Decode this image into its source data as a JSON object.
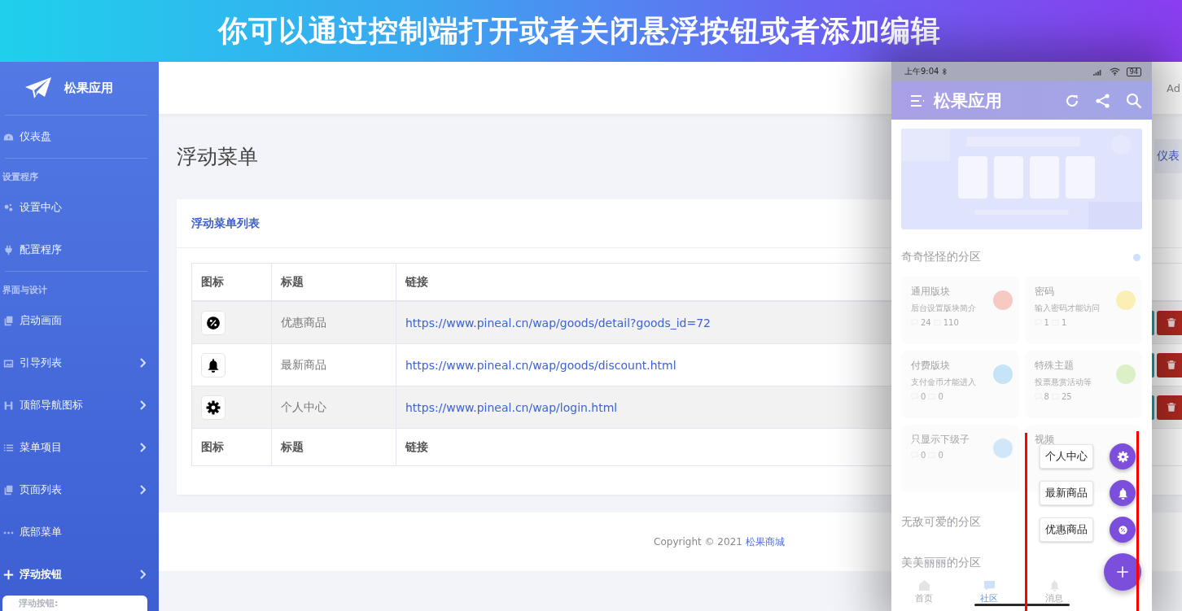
{
  "banner": {
    "title": "你可以通过控制端打开或者关闭悬浮按钮或者添加编辑"
  },
  "sidebar": {
    "brand": "松果应用",
    "groups": [
      {
        "items": [
          {
            "label": "仪表盘",
            "expandable": false,
            "selected": false
          }
        ]
      },
      {
        "label": "设置程序",
        "items": [
          {
            "label": "设置中心",
            "expandable": false,
            "selected": false
          },
          {
            "label": "配置程序",
            "expandable": false,
            "selected": false
          }
        ]
      },
      {
        "label": "界面与设计",
        "items": [
          {
            "label": "启动画面",
            "expandable": false,
            "selected": false
          },
          {
            "label": "引导列表",
            "expandable": true,
            "selected": false
          },
          {
            "label": "顶部导航图标",
            "expandable": true,
            "selected": false
          },
          {
            "label": "菜单项目",
            "expandable": true,
            "selected": false
          },
          {
            "label": "页面列表",
            "expandable": true,
            "selected": false
          },
          {
            "label": "底部菜单",
            "expandable": false,
            "selected": false
          },
          {
            "label": "浮动按钮",
            "expandable": true,
            "expanded": true,
            "selected": true,
            "children": [
              {
                "label": "浮动按钮:"
              }
            ]
          }
        ]
      }
    ]
  },
  "header": {
    "user": "Ad"
  },
  "page": {
    "title": "浮动菜单",
    "breadcrumb": "仪表"
  },
  "card": {
    "title": "浮动菜单列表",
    "columns": [
      "图标",
      "标题",
      "链接"
    ],
    "rows": [
      {
        "title": "优惠商品",
        "link": "https://www.pineal.cn/wap/goods/detail?goods_id=72"
      },
      {
        "title": "最新商品",
        "link": "https://www.pineal.cn/wap/goods/discount.html"
      },
      {
        "title": "个人中心",
        "link": "https://www.pineal.cn/wap/login.html"
      }
    ],
    "footer_columns": [
      "图标",
      "标题",
      "链接"
    ]
  },
  "footer": {
    "text": "Copyright © 2021",
    "link": "松果商城"
  },
  "phone": {
    "status_bar": {
      "time": "上午9:04",
      "battery": "94"
    },
    "app_title": "松果应用",
    "sections": [
      {
        "title": "奇奇怪怪的分区",
        "forums": [
          {
            "title": "通用版块",
            "description": "后台设置版块简介",
            "comments": "24",
            "posts": "110",
            "color": "#f6c9c2"
          },
          {
            "title": "密码",
            "description": "输入密码才能访问",
            "comments": "1",
            "posts": "1",
            "color": "#fbefb3"
          },
          {
            "title": "付费版块",
            "description": "支付金币才能进入",
            "comments": "0",
            "posts": "0",
            "color": "#c6e4f8"
          },
          {
            "title": "特殊主题",
            "description": "投票悬赏活动等",
            "comments": "8",
            "posts": "25",
            "color": "#dcefc7"
          },
          {
            "title": "只显示下级子",
            "comments": "0",
            "posts": "0",
            "color": "#cfe7f8"
          },
          {
            "title": "视频"
          }
        ]
      },
      {
        "title": "无敌可爱的分区"
      },
      {
        "title": "美美丽丽的分区"
      }
    ],
    "tabs": [
      {
        "label": "首页",
        "selected": false
      },
      {
        "label": "社区",
        "selected": true
      },
      {
        "label": "消息",
        "selected": false
      }
    ],
    "fab": {
      "items": [
        {
          "label": "个人中心"
        },
        {
          "label": "最新商品"
        },
        {
          "label": "优惠商品"
        }
      ]
    }
  }
}
